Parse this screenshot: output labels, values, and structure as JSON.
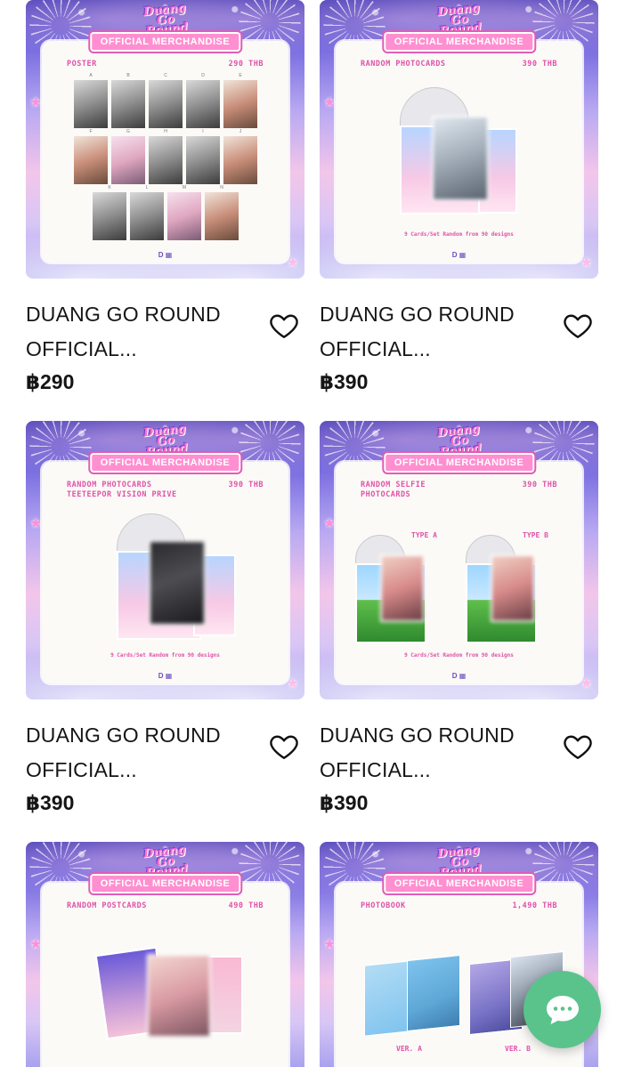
{
  "products": [
    {
      "title": "DUANG GO ROUND OFFICIAL...",
      "price": "฿290",
      "image": {
        "logo": [
          "Duang",
          "Go",
          "Round"
        ],
        "banner": "OFFICIAL MERCHANDISE",
        "label_left": "POSTER",
        "label_right": "290 THB",
        "poster_letters": [
          [
            "A",
            "B",
            "C",
            "D",
            "E"
          ],
          [
            "F",
            "G",
            "H",
            "I",
            "J"
          ],
          [
            "K",
            "L",
            "M",
            "N"
          ]
        ]
      },
      "wishlist_icon": "heart-outline-icon"
    },
    {
      "title": "DUANG GO ROUND OFFICIAL...",
      "price": "฿390",
      "image": {
        "logo": [
          "Duang",
          "Go",
          "Round"
        ],
        "banner": "OFFICIAL MERCHANDISE",
        "label_left": "RANDOM PHOTOCARDS",
        "label_right": "390 THB",
        "footnote": "9 Cards/Set Random from 90 designs"
      },
      "wishlist_icon": "heart-outline-icon"
    },
    {
      "title": "DUANG GO ROUND OFFICIAL...",
      "price": "฿390",
      "image": {
        "logo": [
          "Duang",
          "Go",
          "Round"
        ],
        "banner": "OFFICIAL MERCHANDISE",
        "label_left": "RANDOM PHOTOCARDS\nTEETEEPOR VISION PRIVE",
        "label_right": "390 THB",
        "footnote": "9 Cards/Set Random from 90 designs"
      },
      "wishlist_icon": "heart-outline-icon"
    },
    {
      "title": "DUANG GO ROUND OFFICIAL...",
      "price": "฿390",
      "image": {
        "logo": [
          "Duang",
          "Go",
          "Round"
        ],
        "banner": "OFFICIAL MERCHANDISE",
        "label_left": "RANDOM SELFIE\nPHOTOCARDS",
        "label_right": "390 THB",
        "type_a": "TYPE A",
        "type_b": "TYPE B",
        "footnote": "9 Cards/Set Random from 90 designs"
      },
      "wishlist_icon": "heart-outline-icon"
    },
    {
      "image": {
        "logo": [
          "Duang",
          "Go",
          "Round"
        ],
        "banner": "OFFICIAL MERCHANDISE",
        "label_left": "RANDOM POSTCARDS",
        "label_right": "490 THB"
      }
    },
    {
      "image": {
        "logo": [
          "Duang",
          "Go",
          "Round"
        ],
        "banner": "OFFICIAL MERCHANDISE",
        "label_left": "PHOTOBOOK",
        "label_right": "1,490 THB",
        "ver_a": "VER. A",
        "ver_b": "VER. B"
      }
    }
  ],
  "chat_button": {
    "icon": "chat-bubble-icon"
  },
  "colors": {
    "accent_green": "#5ac38c",
    "banner_pink": "#ff8fd0",
    "label_pink": "#e052a8"
  }
}
